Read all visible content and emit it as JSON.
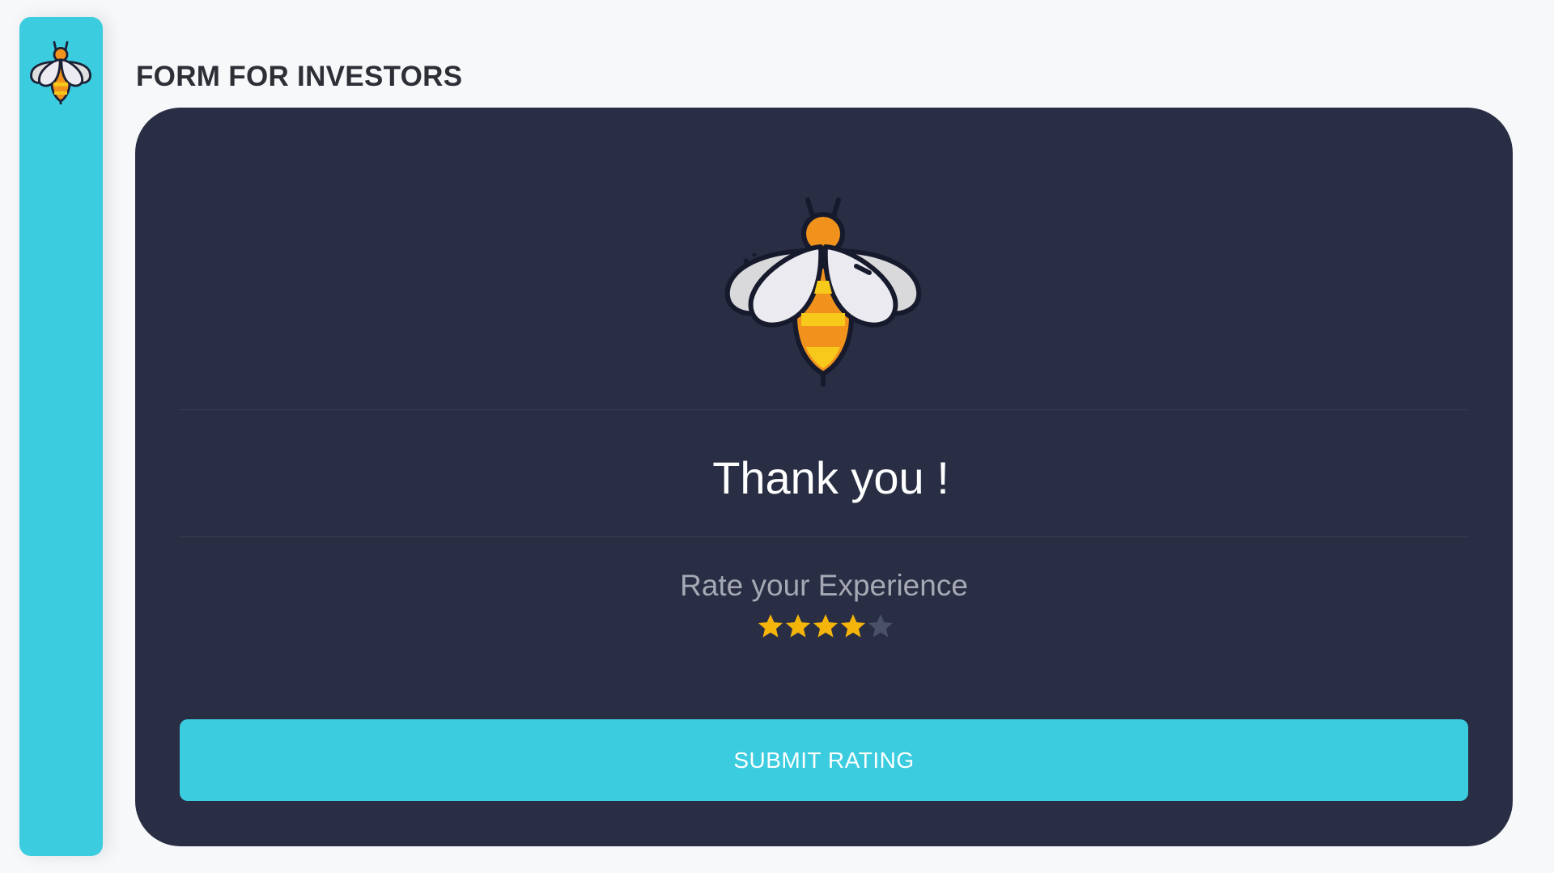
{
  "page": {
    "title": "FORM FOR INVESTORS"
  },
  "sidebar": {
    "logo_icon": "bee-icon"
  },
  "card": {
    "hero_icon": "bee-icon",
    "heading": "Thank you !",
    "rating": {
      "label": "Rate your Experience",
      "value": 4,
      "max": 5
    },
    "submit_label": "SUBMIT RATING"
  },
  "colors": {
    "accent": "#3bcce0",
    "card_background": "#292e44",
    "page_background": "#f7f8fa",
    "star_filled": "#f5b40a",
    "star_empty": "#4a5068"
  }
}
